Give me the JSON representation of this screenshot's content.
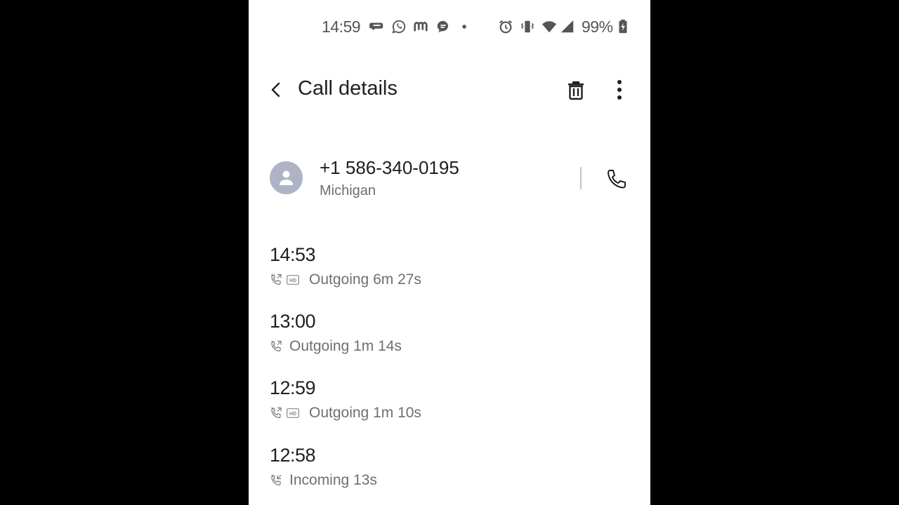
{
  "status_bar": {
    "time": "14:59",
    "battery": "99%",
    "icons": [
      "messages-icon",
      "whatsapp-icon",
      "app-m-icon",
      "chat-bubble-icon",
      "dot-icon",
      "alarm-icon",
      "vibrate-icon",
      "wifi-icon",
      "signal-icon",
      "battery-charging-icon"
    ]
  },
  "app_bar": {
    "title": "Call details",
    "icons": [
      "back-arrow-icon",
      "trash-icon",
      "more-vert-icon"
    ]
  },
  "contact": {
    "number": "+1 586-340-0195",
    "location": "Michigan",
    "avatar_color": "#aeb3c6"
  },
  "calls": [
    {
      "time": "14:53",
      "direction": "outgoing",
      "hd": true,
      "desc": "Outgoing 6m 27s"
    },
    {
      "time": "13:00",
      "direction": "outgoing",
      "hd": false,
      "desc": "Outgoing 1m 14s"
    },
    {
      "time": "12:59",
      "direction": "outgoing",
      "hd": true,
      "desc": "Outgoing 1m 10s"
    },
    {
      "time": "12:58",
      "direction": "incoming",
      "hd": false,
      "desc": "Incoming 13s"
    }
  ],
  "colors": {
    "primary_text": "#1f1f1f",
    "secondary_text": "#6f6f6f",
    "icon_gray": "#555555",
    "background": "#ffffff",
    "letterbox": "#000000"
  }
}
